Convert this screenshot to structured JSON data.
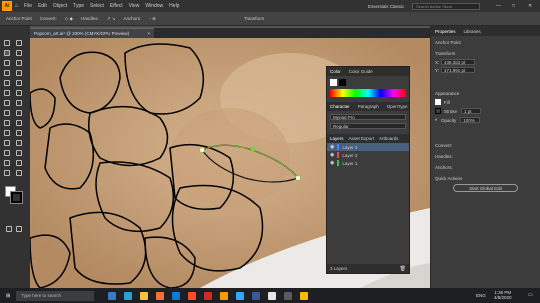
{
  "app": {
    "logo": "Ai",
    "menu": [
      "File",
      "Edit",
      "Object",
      "Type",
      "Select",
      "Effect",
      "View",
      "Window",
      "Help"
    ],
    "workspace": "Essentials Classic",
    "search_placeholder": "Search Adobe Stock"
  },
  "control_bar": {
    "label": "Anchor Point",
    "convert": "Convert:",
    "handles": "Handles:",
    "anchors": "Anchors:",
    "transform": "Transform"
  },
  "document": {
    "tab_title": "Popcorn_art.ai* @ 200% (CMYK/GPU Preview)",
    "close": "×"
  },
  "color_panel": {
    "tabs": [
      "Color",
      "Color Guide"
    ]
  },
  "character_panel": {
    "tabs": [
      "Character",
      "Paragraph",
      "OpenType"
    ],
    "font": "Myriad Pro",
    "style": "Regular"
  },
  "layers_panel": {
    "tabs": [
      "Layers",
      "Asset Export",
      "Artboards"
    ],
    "layers": [
      {
        "name": "Layer 3",
        "color": "#4f7dff",
        "selected": true
      },
      {
        "name": "Layer 2",
        "color": "#e14b4b",
        "selected": false
      },
      {
        "name": "Layer 1",
        "color": "#3fc34f",
        "selected": false
      }
    ],
    "footer": "3 Layers"
  },
  "properties": {
    "tabs": [
      "Properties",
      "Libraries"
    ],
    "anchor_point": "Anchor Point",
    "transform": "Transform",
    "x_value": "436.362 pt",
    "y_value": "371.991 pt",
    "appearance": "Appearance",
    "fill": "Fill",
    "stroke": "Stroke",
    "stroke_value": "1 pt",
    "opacity": "Opacity",
    "opacity_value": "100%",
    "convert": "Convert:",
    "handles": "Handles:",
    "anchors": "Anchors:",
    "quick_actions": "Quick Actions",
    "start_global_edit": "Start Global Edit"
  },
  "taskbar": {
    "search": "Type here to search",
    "lang": "ENG",
    "time": "1:36 PM",
    "date": "4/8/2020"
  },
  "colors": {
    "accent": "#2d8ceb",
    "selection_path": "#7dd13a"
  }
}
